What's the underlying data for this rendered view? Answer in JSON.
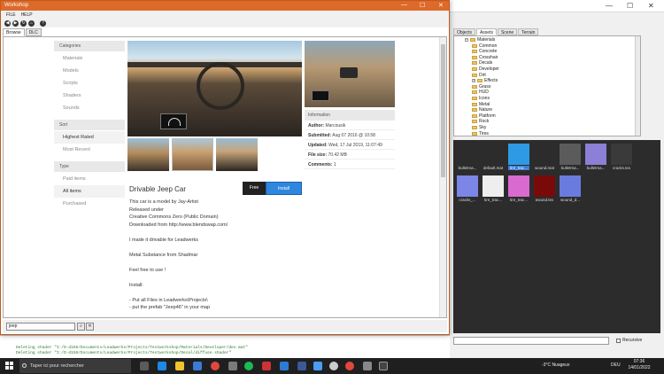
{
  "window": {
    "title": "Workshop",
    "controls": [
      "—",
      "☐",
      "✕"
    ]
  },
  "menu": [
    "FILE",
    "HELP"
  ],
  "toolbar": [
    {
      "name": "back-icon",
      "glyph": "◀"
    },
    {
      "name": "forward-icon",
      "glyph": "▶"
    },
    {
      "name": "refresh-icon",
      "glyph": "↻"
    },
    {
      "name": "home-icon",
      "glyph": "⌂"
    },
    {
      "name": "help-icon",
      "glyph": "?"
    }
  ],
  "tabs": [
    "Browse",
    "DLC"
  ],
  "sidebar": {
    "categories_header": "Categories",
    "categories": [
      "Materials",
      "Models",
      "Scripts",
      "Shaders",
      "Sounds"
    ],
    "sort_header": "Sort",
    "sort": [
      "Highest Rated",
      "Most Recent"
    ],
    "type_header": "Type",
    "type": [
      "Paid items",
      "All items",
      "Purchased"
    ]
  },
  "info": {
    "header": "Information",
    "author_label": "Author:",
    "author": "Marcousik",
    "submitted_label": "Submitted:",
    "submitted": "Aug 07 2016 @ 10:58",
    "updated_label": "Updated:",
    "updated": "Wed, 17 Jul 2019, 11:07:49",
    "filesize_label": "File size:",
    "filesize": "70.42 MB",
    "comments_label": "Comments:",
    "comments": "1"
  },
  "item": {
    "title": "Drivable Jeep Car",
    "free_label": "Free",
    "install_label": "Install",
    "description": [
      "This car is a model by Jay-Artist",
      "Released under",
      "Creative Commons Zero (Public Domain)",
      "Downloaded from http://www.blendswap.com/",
      "",
      "I made it drivable for Leadwerks",
      "",
      "Metal Substance from Shadmar",
      "",
      "Feel free to use !",
      "",
      "Install:",
      "",
      "- Put all Files in Leadwerks\\Projects\\",
      "- put the prefab \"Jeep46\" in your map"
    ]
  },
  "search": {
    "value": "jeep",
    "search_glyph": "⌕",
    "clear_glyph": "✕"
  },
  "console": [
    "Deleting shader \"I:/D-d156/Documents/Leadwerks/Projects/Testworkshop/Materials/Developer/dev.mat\"",
    "Deleting shader \"I:/D-d156/Documents/Leadwerks/Projects/Testworkshop/Decal/diffuse.shader\""
  ],
  "editor": {
    "controls": [
      "—",
      "☐",
      "✕"
    ],
    "tabs": [
      "Objects",
      "Assets",
      "Scene",
      "Terrain"
    ],
    "tree": [
      {
        "label": "Materials",
        "depth": 1,
        "expander": "−"
      },
      {
        "label": "Common",
        "depth": 2
      },
      {
        "label": "Concrete",
        "depth": 2
      },
      {
        "label": "Crosshair",
        "depth": 2
      },
      {
        "label": "Decals",
        "depth": 2
      },
      {
        "label": "Developer",
        "depth": 2
      },
      {
        "label": "Dirt",
        "depth": 2
      },
      {
        "label": "Effects",
        "depth": 2,
        "expander": "+"
      },
      {
        "label": "Grass",
        "depth": 2
      },
      {
        "label": "HUD",
        "depth": 2
      },
      {
        "label": "Icons",
        "depth": 2
      },
      {
        "label": "Metal",
        "depth": 2
      },
      {
        "label": "Nature",
        "depth": 2
      },
      {
        "label": "Platform",
        "depth": 2
      },
      {
        "label": "Rock",
        "depth": 2
      },
      {
        "label": "Sky",
        "depth": 2
      },
      {
        "label": "Tires",
        "depth": 2
      }
    ],
    "assets": [
      {
        "label": "bulletma...",
        "color": "#2c2c2c"
      },
      {
        "label": "default.mat",
        "color": "#2c2c2c"
      },
      {
        "label": "tire_trac...",
        "color": "#2e9ae6",
        "selected": true
      },
      {
        "label": "wound.mat",
        "color": "#2c2c2c"
      },
      {
        "label": "bulletma...",
        "color": "#5b5b5b"
      },
      {
        "label": "bulletma...",
        "color": "#8b7fd6"
      },
      {
        "label": "cracks.tex",
        "color": "#3a3a3a"
      },
      {
        "label": "cracks_...",
        "color": "#7c86e6"
      },
      {
        "label": "tire_trac...",
        "color": "#eeeeee"
      },
      {
        "label": "tire_trac...",
        "color": "#d86ad0"
      },
      {
        "label": "wound.tex",
        "color": "#7a0a0a"
      },
      {
        "label": "wound_d...",
        "color": "#6a7be0"
      }
    ],
    "recursive_label": "Recursive"
  },
  "taskbar": {
    "search_placeholder": "Taper ici pour rechercher",
    "weather": "-3°C  Nuageux",
    "lang": "DEU",
    "time": "07:36",
    "date": "14/01/2022"
  }
}
